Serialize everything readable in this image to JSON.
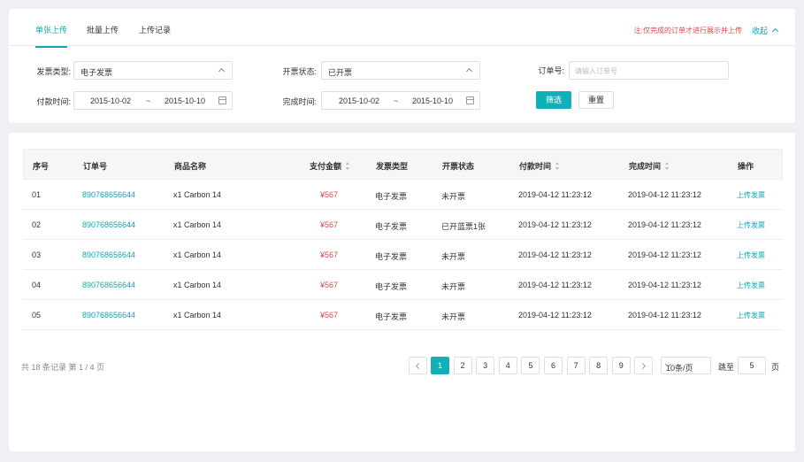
{
  "tabs": [
    {
      "label": "单张上传"
    },
    {
      "label": "批量上传"
    },
    {
      "label": "上传记录"
    }
  ],
  "notice": "注:仅完成的订单才进行展示并上传",
  "collapse_label": "收起",
  "filters": {
    "invoice_type_label": "发票类型:",
    "invoice_type_value": "电子发票",
    "invoice_status_label": "开票状态:",
    "invoice_status_value": "已开票",
    "order_no_label": "订单号:",
    "order_no_placeholder": "请输入订单号",
    "pay_time_label": "付款时间:",
    "pay_time_start": "2015-10-02",
    "pay_time_end": "2015-10-10",
    "done_time_label": "完成时间:",
    "done_time_start": "2015-10-02",
    "done_time_end": "2015-10-10",
    "range_sep": "~",
    "filter_button": "筛选",
    "reset_button": "重置"
  },
  "table": {
    "headers": {
      "index": "序号",
      "order_no": "订单号",
      "product": "商品名称",
      "amount": "支付金额",
      "invoice_type": "发票类型",
      "invoice_status": "开票状态",
      "pay_time": "付款时间",
      "done_time": "完成时间",
      "action": "操作"
    },
    "rows": [
      {
        "index": "01",
        "order_no": "890768656644",
        "product": "x1 Carbon 14",
        "amount": "¥567",
        "invoice_type": "电子发票",
        "invoice_status": "未开票",
        "pay_time": "2019-04-12 11:23:12",
        "done_time": "2019-04-12 11:23:12",
        "action": "上传发票"
      },
      {
        "index": "02",
        "order_no": "890768656644",
        "product": "x1 Carbon 14",
        "amount": "¥567",
        "invoice_type": "电子发票",
        "invoice_status": "已开蓝票1张",
        "pay_time": "2019-04-12 11:23:12",
        "done_time": "2019-04-12 11:23:12",
        "action": "上传发票"
      },
      {
        "index": "03",
        "order_no": "890768656644",
        "product": "x1 Carbon 14",
        "amount": "¥567",
        "invoice_type": "电子发票",
        "invoice_status": "未开票",
        "pay_time": "2019-04-12 11:23:12",
        "done_time": "2019-04-12 11:23:12",
        "action": "上传发票"
      },
      {
        "index": "04",
        "order_no": "890768656644",
        "product": "x1 Carbon 14",
        "amount": "¥567",
        "invoice_type": "电子发票",
        "invoice_status": "未开票",
        "pay_time": "2019-04-12 11:23:12",
        "done_time": "2019-04-12 11:23:12",
        "action": "上传发票"
      },
      {
        "index": "05",
        "order_no": "890768656644",
        "product": "x1 Carbon 14",
        "amount": "¥567",
        "invoice_type": "电子发票",
        "invoice_status": "未开票",
        "pay_time": "2019-04-12 11:23:12",
        "done_time": "2019-04-12 11:23:12",
        "action": "上传发票"
      }
    ]
  },
  "pagination": {
    "summary": "共 18 条记录 第 1 / 4 页",
    "pages": [
      "1",
      "2",
      "3",
      "4",
      "5",
      "6",
      "7",
      "8",
      "9"
    ],
    "current": "1",
    "page_size": "10条/页",
    "jump_label": "跳至",
    "jump_value": "5",
    "page_unit": "页"
  },
  "icons": {
    "collapse": "chevron-up-icon",
    "select_arrow": "chevron-up-icon",
    "calendar": "calendar-icon",
    "sort": "sort-icon",
    "prev": "chevron-left-icon",
    "next": "chevron-right-icon"
  },
  "colors": {
    "accent": "#10b0b8",
    "link": "#10a6b3",
    "danger": "#e84545"
  }
}
